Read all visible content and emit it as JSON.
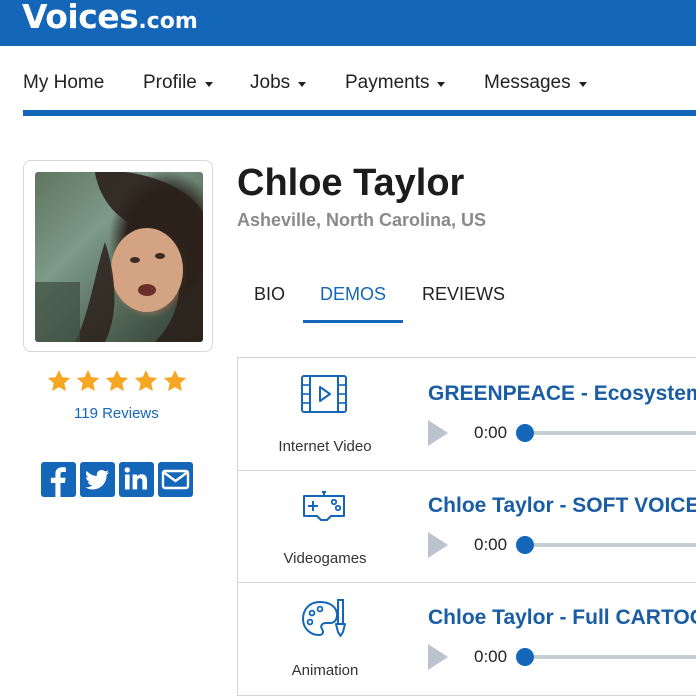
{
  "brand": {
    "name": "Voices",
    "suffix": ".com"
  },
  "nav": {
    "items": [
      {
        "label": "My Home",
        "dropdown": false
      },
      {
        "label": "Profile",
        "dropdown": true
      },
      {
        "label": "Jobs",
        "dropdown": true
      },
      {
        "label": "Payments",
        "dropdown": true
      },
      {
        "label": "Messages",
        "dropdown": true
      }
    ]
  },
  "profile": {
    "name": "Chloe Taylor",
    "location": "Asheville, North Carolina, US",
    "rating_stars": 5,
    "reviews_label": "119 Reviews"
  },
  "socials": [
    "facebook-icon",
    "twitter-icon",
    "linkedin-icon",
    "email-icon"
  ],
  "tabs": [
    {
      "label": "BIO",
      "active": false
    },
    {
      "label": "DEMOS",
      "active": true
    },
    {
      "label": "REVIEWS",
      "active": false
    }
  ],
  "demos": [
    {
      "category": "Internet Video",
      "icon": "video-film-icon",
      "title": "GREENPEACE - Ecosystem",
      "time": "0:00"
    },
    {
      "category": "Videogames",
      "icon": "gamepad-icon",
      "title": "Chloe Taylor - SOFT VOICE /",
      "time": "0:00"
    },
    {
      "category": "Animation",
      "icon": "palette-brush-icon",
      "title": "Chloe Taylor - Full CARTOON",
      "time": "0:00"
    }
  ],
  "colors": {
    "brand_blue": "#1466b8",
    "link_blue": "#1a5da4",
    "star_orange": "#f5a623",
    "muted_gray": "#8a8a8a"
  }
}
